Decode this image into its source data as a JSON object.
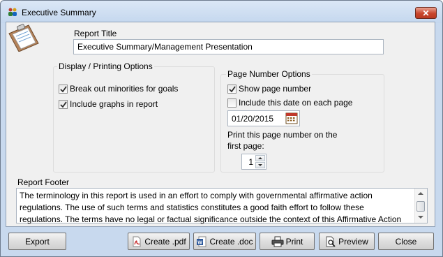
{
  "window": {
    "title": "Executive Summary",
    "close_label": "✕"
  },
  "report_title": {
    "label": "Report Title",
    "value": "Executive Summary/Management Presentation"
  },
  "display_options": {
    "title": "Display / Printing Options",
    "break_out_minorities": {
      "label": "Break out minorities for goals",
      "checked": true
    },
    "include_graphs": {
      "label": "Include graphs in report",
      "checked": true
    }
  },
  "page_number_options": {
    "title": "Page Number Options",
    "show_page_number": {
      "label": "Show page number",
      "checked": true
    },
    "include_date": {
      "label": "Include this date on each page",
      "checked": false
    },
    "date_value": "01/20/2015",
    "first_page_label_line1": "Print this page number on the",
    "first_page_label_line2": "first page:",
    "first_page_value": "1"
  },
  "report_footer": {
    "label": "Report Footer",
    "line1": "The terminology in this report is used in an effort to comply with governmental affirmative action",
    "line2": "regulations. The use of such terms and statistics constitutes a good faith effort to follow these",
    "line3": "regulations. The terms have no legal or factual significance outside the context of this Affirmative Action"
  },
  "buttons": {
    "export": "Export",
    "create_pdf": "Create .pdf",
    "create_doc": "Create .doc",
    "print": "Print",
    "preview": "Preview",
    "close": "Close"
  },
  "icons": {
    "title": "people-icon",
    "clipboard": "clipboard-icon",
    "calendar": "calendar-icon",
    "pdf": "pdf-icon",
    "word": "word-doc-icon",
    "print": "printer-icon",
    "preview": "preview-icon"
  }
}
